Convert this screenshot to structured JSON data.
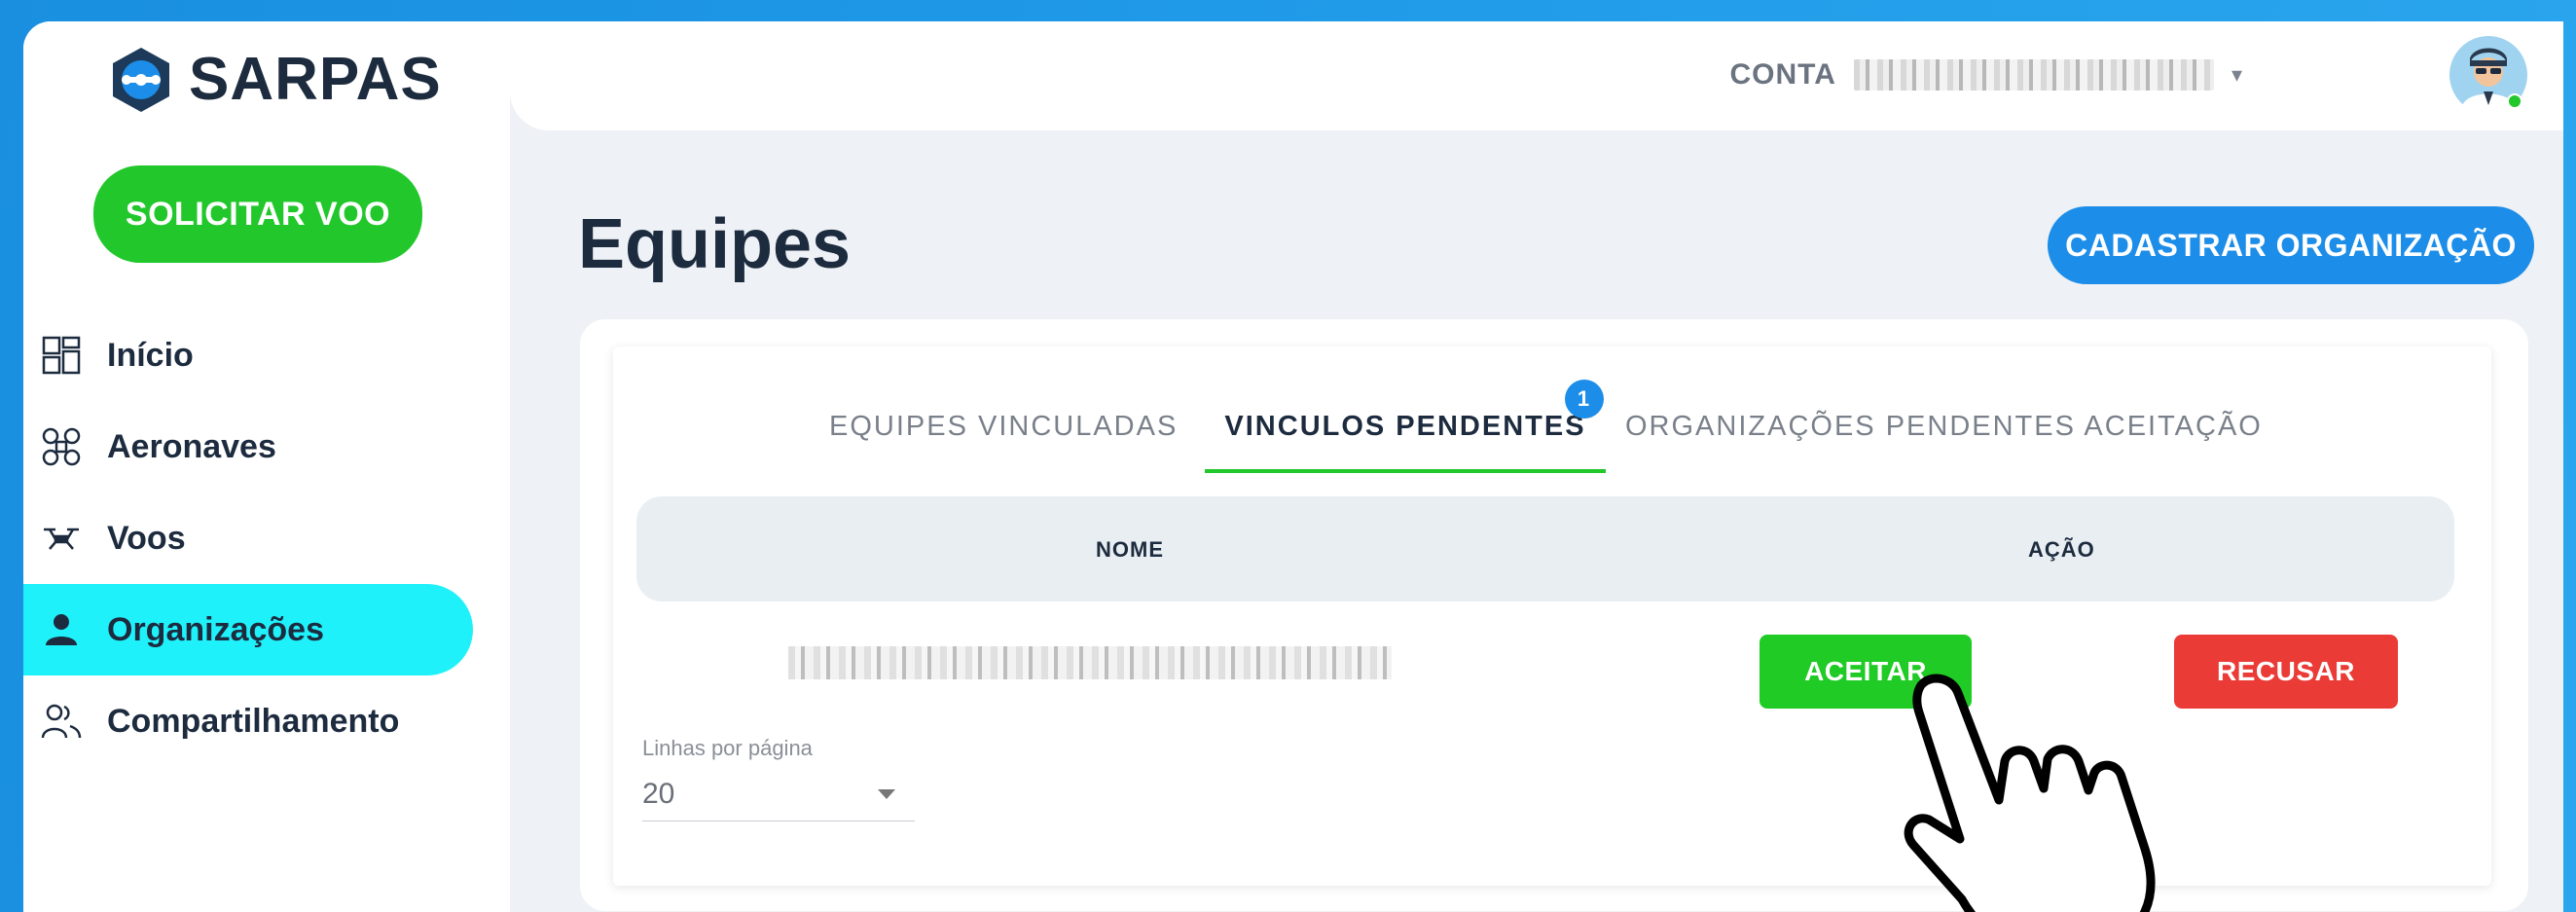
{
  "app": {
    "logo_text": "SARPAS",
    "logo_icon": "drone-logo-icon"
  },
  "sidebar": {
    "cta_label": "SOLICITAR VOO",
    "items": [
      {
        "label": "Início",
        "icon": "dashboard-grid-icon",
        "active": false
      },
      {
        "label": "Aeronaves",
        "icon": "drone-icon",
        "active": false
      },
      {
        "label": "Voos",
        "icon": "flight-drone-icon",
        "active": false
      },
      {
        "label": "Organizações",
        "icon": "person-icon",
        "active": true
      },
      {
        "label": "Compartilhamento",
        "icon": "people-share-icon",
        "active": false
      }
    ]
  },
  "header": {
    "account_label": "CONTA",
    "avatar_icon": "pilot-avatar-icon"
  },
  "page": {
    "title": "Equipes",
    "primary_action": "CADASTRAR ORGANIZAÇÃO"
  },
  "tabs": [
    {
      "label": "EQUIPES VINCULADAS",
      "active": false
    },
    {
      "label": "VINCULOS PENDENTES",
      "active": true,
      "badge": "1"
    },
    {
      "label": "ORGANIZAÇÕES PENDENTES ACEITAÇÃO",
      "active": false
    }
  ],
  "table": {
    "headers": {
      "name": "NOME",
      "action": "AÇÃO"
    },
    "rows": [
      {
        "accept_label": "ACEITAR",
        "reject_label": "RECUSAR"
      }
    ]
  },
  "pagination": {
    "rows_per_page_label": "Linhas por página",
    "rows_per_page_value": "20"
  },
  "colors": {
    "accent_green": "#21c72b",
    "accent_blue": "#1c8de8",
    "danger": "#ea3b36",
    "active_nav": "#1ff1fb"
  }
}
